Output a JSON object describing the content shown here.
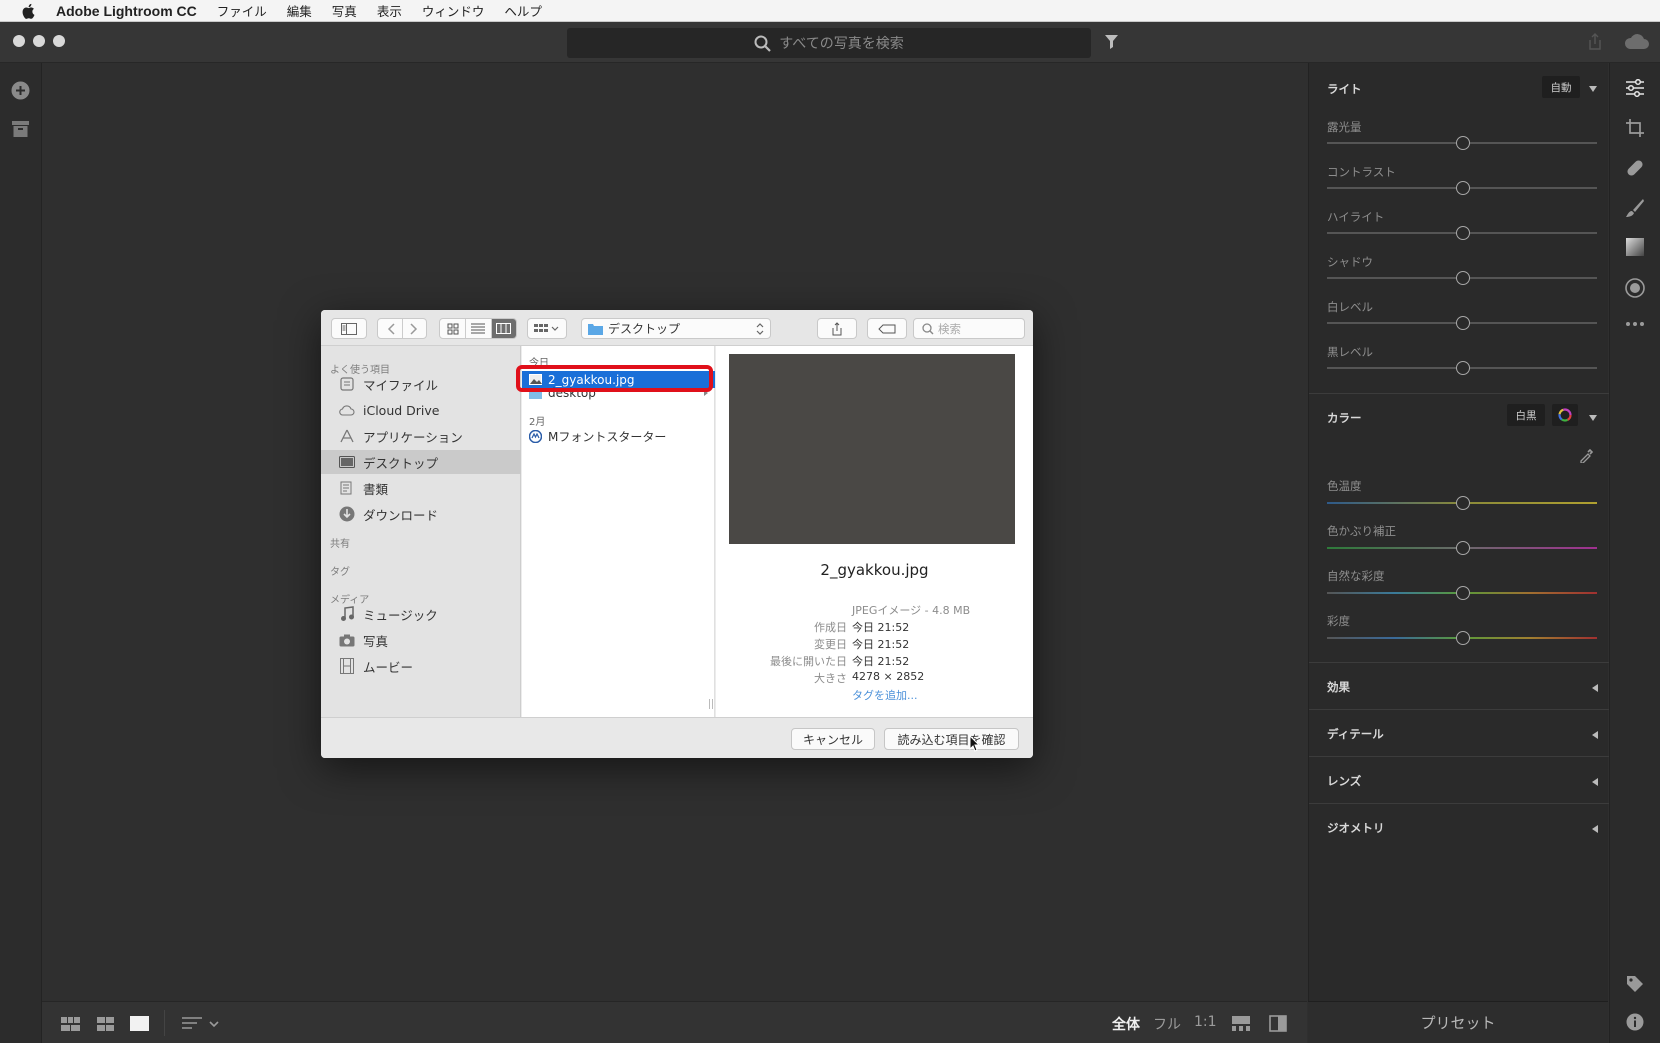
{
  "menubar": {
    "app_name": "Adobe Lightroom CC",
    "items": [
      "ファイル",
      "編集",
      "写真",
      "表示",
      "ウィンドウ",
      "ヘルプ"
    ]
  },
  "titlebar": {
    "search_placeholder": "すべての写真を検索"
  },
  "dialog": {
    "location": "デスクトップ",
    "search_placeholder": "検索",
    "sidebar": {
      "favorites_header": "よく使う項目",
      "favorites": [
        {
          "label": "マイファイル",
          "icon": "all-files-icon"
        },
        {
          "label": "iCloud Drive",
          "icon": "cloud-icon"
        },
        {
          "label": "アプリケーション",
          "icon": "applications-icon"
        },
        {
          "label": "デスクトップ",
          "icon": "desktop-icon",
          "selected": true
        },
        {
          "label": "書類",
          "icon": "documents-icon"
        },
        {
          "label": "ダウンロード",
          "icon": "downloads-icon"
        }
      ],
      "shared_header": "共有",
      "tags_header": "タグ",
      "media_header": "メディア",
      "media": [
        {
          "label": "ミュージック",
          "icon": "music-icon"
        },
        {
          "label": "写真",
          "icon": "camera-icon"
        },
        {
          "label": "ムービー",
          "icon": "film-icon"
        }
      ]
    },
    "file_column": {
      "today_header": "今日",
      "today_items": [
        "2_gyakkou.jpg",
        "desktop"
      ],
      "feb_header": "2月",
      "feb_items": [
        "Mフォントスターター"
      ]
    },
    "preview": {
      "filename": "2_gyakkou.jpg",
      "kind": "JPEGイメージ - 4.8 MB",
      "created_label": "作成日",
      "created": "今日 21:52",
      "modified_label": "変更日",
      "modified": "今日 21:52",
      "opened_label": "最後に開いた日",
      "opened": "今日 21:52",
      "size_label": "大きさ",
      "size": "4278 × 2852",
      "add_tags": "タグを追加..."
    },
    "cancel_label": "キャンセル",
    "confirm_label": "読み込む項目を確認"
  },
  "right_panel": {
    "light": {
      "title": "ライト",
      "auto_label": "自動",
      "sliders": [
        "露光量",
        "コントラスト",
        "ハイライト",
        "シャドウ",
        "白レベル",
        "黒レベル"
      ]
    },
    "color": {
      "title": "カラー",
      "bw_label": "白黒",
      "sliders": [
        "色温度",
        "色かぶり補正",
        "自然な彩度",
        "彩度"
      ]
    },
    "collapsed_sections": [
      "効果",
      "ディテール",
      "レンズ",
      "ジオメトリ"
    ],
    "presets_label": "プリセット"
  },
  "bottom_bar": {
    "zoom_fit": "全体",
    "zoom_fill": "フル",
    "zoom_1to1": "1:1"
  },
  "colors": {
    "selection_blue": "#1a6fd8",
    "highlight_red": "#e0101a",
    "link_blue": "#4a90d9"
  }
}
